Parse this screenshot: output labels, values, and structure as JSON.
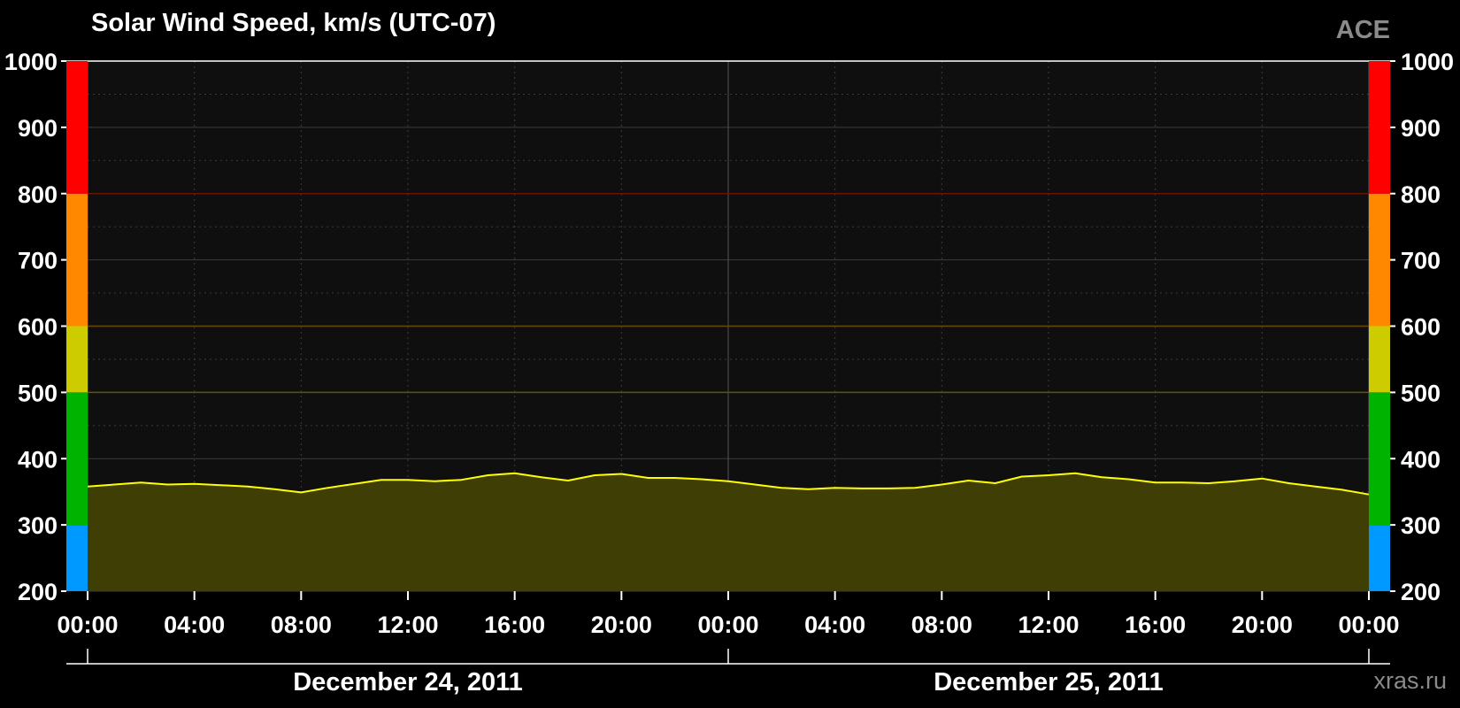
{
  "title": "Solar Wind Speed, km/s (UTC-07)",
  "source_label": "ACE",
  "credit": "xras.ru",
  "colors": {
    "background": "#000000",
    "plot_background": "#0f0f0f",
    "line": "#ffff00",
    "fill": "#3f3e05",
    "grid": "#3c3c3c",
    "bands": [
      {
        "from": 200,
        "to": 300,
        "color": "#0099ff"
      },
      {
        "from": 300,
        "to": 500,
        "color": "#00b300"
      },
      {
        "from": 500,
        "to": 600,
        "color": "#cccc00"
      },
      {
        "from": 600,
        "to": 800,
        "color": "#ff8800"
      },
      {
        "from": 800,
        "to": 1000,
        "color": "#ff0000"
      }
    ],
    "threshold_lines": [
      {
        "value": 500,
        "color": "#5a5a00"
      },
      {
        "value": 600,
        "color": "#6a4a00"
      },
      {
        "value": 800,
        "color": "#6a1500"
      }
    ]
  },
  "chart_data": {
    "type": "area",
    "title": "Solar Wind Speed, km/s (UTC-07)",
    "ylim": [
      200,
      1000
    ],
    "y_ticks": [
      200,
      300,
      400,
      500,
      600,
      700,
      800,
      900,
      1000
    ],
    "x_range_hours": [
      0,
      48
    ],
    "x_tick_hours": [
      0,
      4,
      8,
      12,
      16,
      20,
      24,
      28,
      32,
      36,
      40,
      44,
      48
    ],
    "x_tick_labels": [
      "00:00",
      "04:00",
      "08:00",
      "12:00",
      "16:00",
      "20:00",
      "00:00",
      "04:00",
      "08:00",
      "12:00",
      "16:00",
      "20:00",
      "00:00"
    ],
    "date_labels": [
      {
        "label": "December 24, 2011",
        "center_hour": 12
      },
      {
        "label": "December 25, 2011",
        "center_hour": 36
      }
    ],
    "day_divider_hours": [
      0,
      24,
      48
    ],
    "grid": true,
    "series": [
      {
        "x": [
          0,
          1,
          2,
          3,
          4,
          5,
          6,
          7,
          8,
          9,
          10,
          11,
          12,
          13,
          14,
          15,
          16,
          17,
          18,
          19,
          20,
          21,
          22,
          23,
          24,
          25,
          26,
          27,
          28,
          29,
          30,
          31,
          32,
          33,
          34,
          35,
          36,
          37,
          38,
          39,
          40,
          41,
          42,
          43,
          44,
          45,
          46,
          47,
          48
        ],
        "values": [
          358,
          361,
          364,
          361,
          362,
          360,
          358,
          354,
          349,
          356,
          362,
          368,
          368,
          366,
          368,
          375,
          378,
          372,
          367,
          375,
          377,
          371,
          371,
          369,
          366,
          361,
          356,
          354,
          356,
          355,
          355,
          356,
          361,
          367,
          363,
          373,
          375,
          378,
          372,
          369,
          364,
          364,
          363,
          366,
          370,
          363,
          358,
          353,
          346
        ]
      }
    ]
  }
}
